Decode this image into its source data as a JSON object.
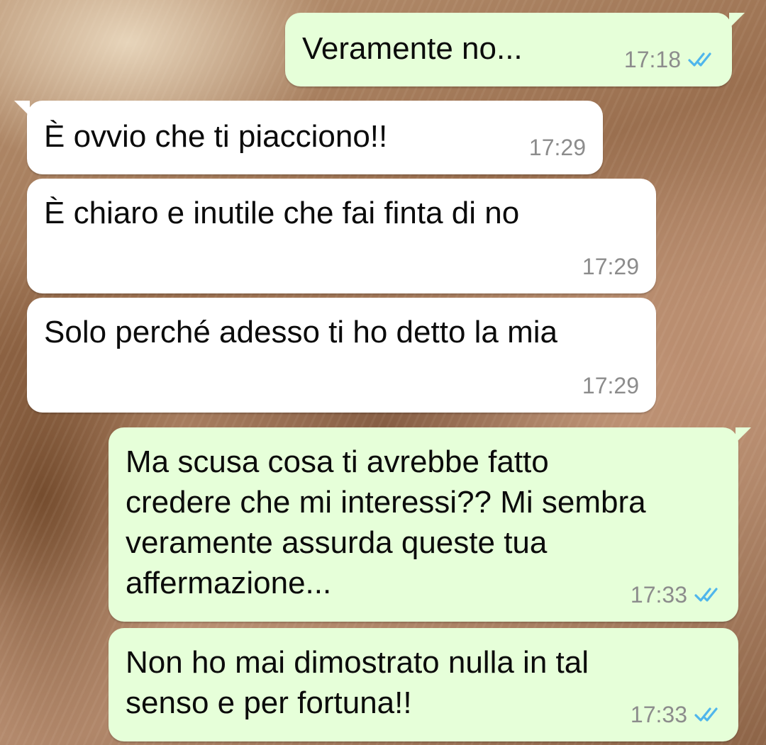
{
  "chat": {
    "messages": [
      {
        "direction": "outgoing",
        "text": "Veramente no...",
        "time": "17:18",
        "status_icon": "double-check-read-icon"
      },
      {
        "direction": "incoming",
        "text": "È ovvio che ti piacciono!!",
        "time": "17:29"
      },
      {
        "direction": "incoming",
        "text": "È chiaro e inutile che fai finta di no",
        "time": "17:29"
      },
      {
        "direction": "incoming",
        "text": "Solo perché adesso ti ho detto la mia",
        "time": "17:29"
      },
      {
        "direction": "outgoing",
        "text": "Ma scusa cosa ti avrebbe fatto\ncredere che mi interessi?? Mi sembra\nveramente assurda queste tua\naffermazione...",
        "time": "17:33",
        "status_icon": "double-check-read-icon"
      },
      {
        "direction": "outgoing",
        "text": "Non ho mai dimostrato nulla in tal\nsenso e per fortuna!!",
        "time": "17:33",
        "status_icon": "double-check-read-icon"
      }
    ]
  },
  "colors": {
    "outgoing_bubble": "#e6ffd9",
    "incoming_bubble": "#ffffff",
    "timestamp": "#8c8c8c",
    "read_ticks": "#4fb6ec"
  }
}
